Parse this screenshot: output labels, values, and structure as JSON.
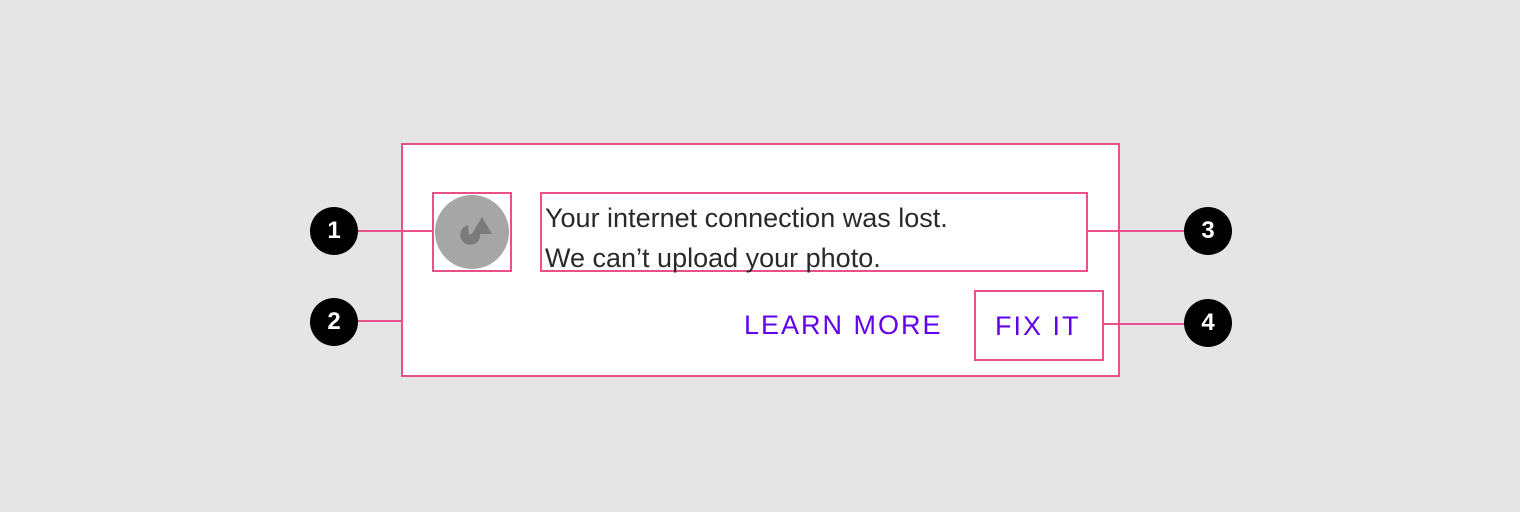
{
  "banner": {
    "message_line_1": "Your internet connection was lost.",
    "message_line_2": "We can’t upload your photo.",
    "learn_more_label": "LEARN MORE",
    "fix_it_label": "FIX IT",
    "avatar_icon": "shapes-icon"
  },
  "callouts": [
    "1",
    "2",
    "3",
    "4"
  ],
  "colors": {
    "background": "#e5e5e5",
    "surface": "#ffffff",
    "annotation": "#e8508a",
    "action": "#6200ee",
    "avatar": "#a6a6a6",
    "callout": "#000000"
  }
}
